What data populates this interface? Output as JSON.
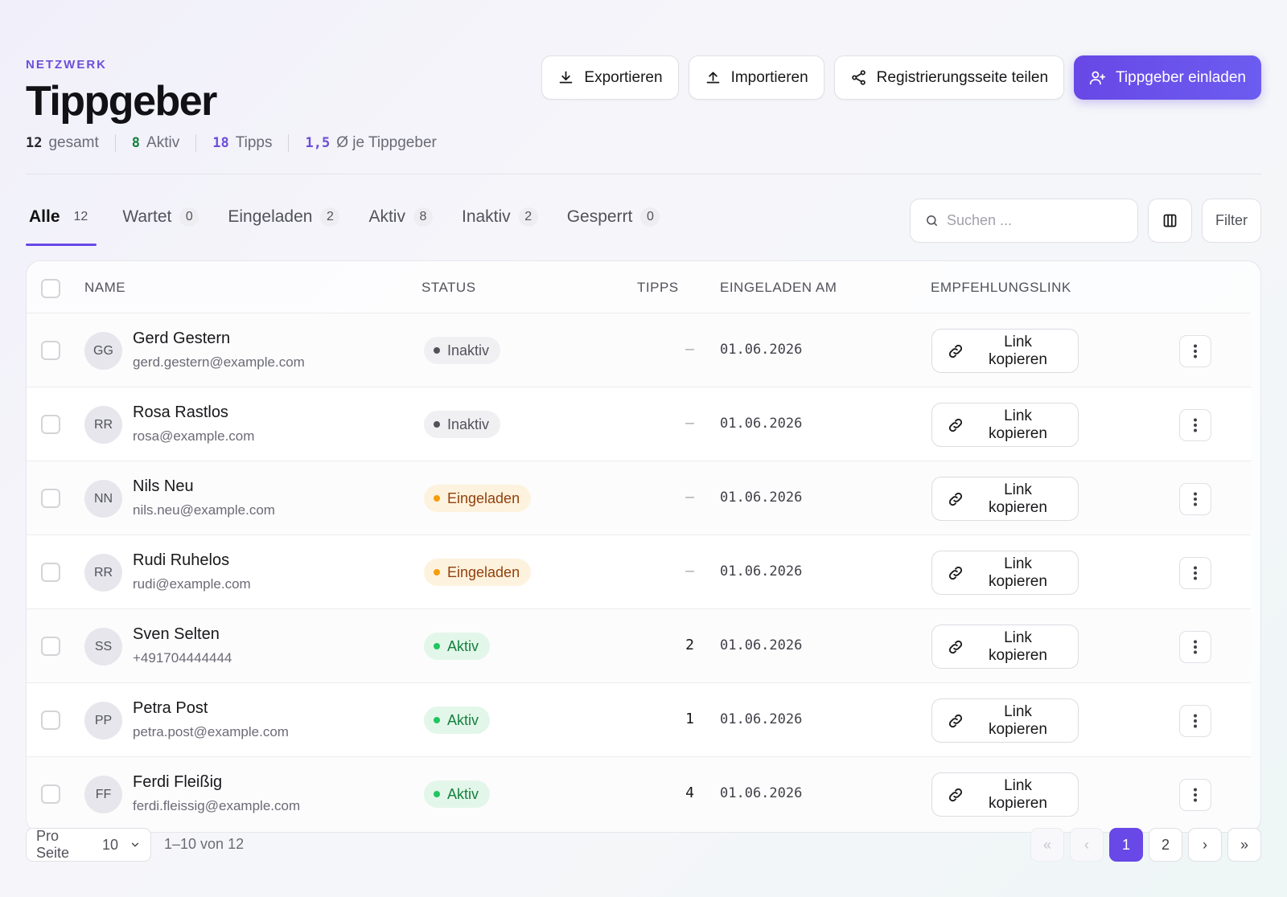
{
  "header": {
    "eyebrow": "NETZWERK",
    "title": "Tippgeber",
    "stats": [
      {
        "value": "12",
        "label": "gesamt"
      },
      {
        "value": "8",
        "label": "Aktiv"
      },
      {
        "value": "18",
        "label": "Tipps"
      },
      {
        "value": "1,5",
        "label": "Ø je Tippgeber"
      }
    ],
    "actions": {
      "export": "Exportieren",
      "import": "Importieren",
      "share": "Registrierungsseite teilen",
      "invite": "Tippgeber einladen"
    }
  },
  "tabs": [
    {
      "label": "Alle",
      "count": "12"
    },
    {
      "label": "Wartet",
      "count": "0"
    },
    {
      "label": "Eingeladen",
      "count": "2"
    },
    {
      "label": "Aktiv",
      "count": "8"
    },
    {
      "label": "Inaktiv",
      "count": "2"
    },
    {
      "label": "Gesperrt",
      "count": "0"
    }
  ],
  "toolbar": {
    "search_placeholder": "Suchen ...",
    "filter_label": "Filter"
  },
  "table": {
    "columns": [
      "NAME",
      "STATUS",
      "TIPPS",
      "EINGELADEN AM",
      "EMPFEHLUNGSLINK"
    ],
    "link_label": "Link kopieren",
    "rows": [
      {
        "initials": "GG",
        "name": "Gerd Gestern",
        "contact": "gerd.gestern@example.com",
        "status": "Inaktiv",
        "tipps": "–",
        "date": "01.06.2026"
      },
      {
        "initials": "RR",
        "name": "Rosa Rastlos",
        "contact": "rosa@example.com",
        "status": "Inaktiv",
        "tipps": "–",
        "date": "01.06.2026"
      },
      {
        "initials": "NN",
        "name": "Nils Neu",
        "contact": "nils.neu@example.com",
        "status": "Eingeladen",
        "tipps": "–",
        "date": "01.06.2026"
      },
      {
        "initials": "RR",
        "name": "Rudi Ruhelos",
        "contact": "rudi@example.com",
        "status": "Eingeladen",
        "tipps": "–",
        "date": "01.06.2026"
      },
      {
        "initials": "SS",
        "name": "Sven Selten",
        "contact": "+491704444444",
        "status": "Aktiv",
        "tipps": "2",
        "date": "01.06.2026"
      },
      {
        "initials": "PP",
        "name": "Petra Post",
        "contact": "petra.post@example.com",
        "status": "Aktiv",
        "tipps": "1",
        "date": "01.06.2026"
      },
      {
        "initials": "FF",
        "name": "Ferdi Fleißig",
        "contact": "ferdi.fleissig@example.com",
        "status": "Aktiv",
        "tipps": "4",
        "date": "01.06.2026"
      }
    ]
  },
  "footer": {
    "per_page_label": "Pro Seite",
    "per_page_value": "10",
    "range": "1–10 von 12",
    "pages": [
      "1",
      "2"
    ],
    "current_page": "1",
    "first": "«",
    "prev": "‹",
    "next": "›",
    "last": "»"
  },
  "colors": {
    "accent": "#6848e6",
    "active_green": "#22c55e",
    "invited_amber": "#f59e0b"
  }
}
